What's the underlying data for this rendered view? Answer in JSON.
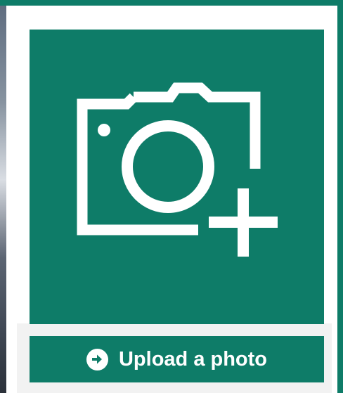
{
  "upload": {
    "button_label": "Upload a photo",
    "tile_icon": "camera-add-icon",
    "button_icon": "arrow-right-circle-icon"
  },
  "colors": {
    "accent": "#0e7c68",
    "icon_fg": "#ffffff",
    "background": "#ffffff"
  }
}
